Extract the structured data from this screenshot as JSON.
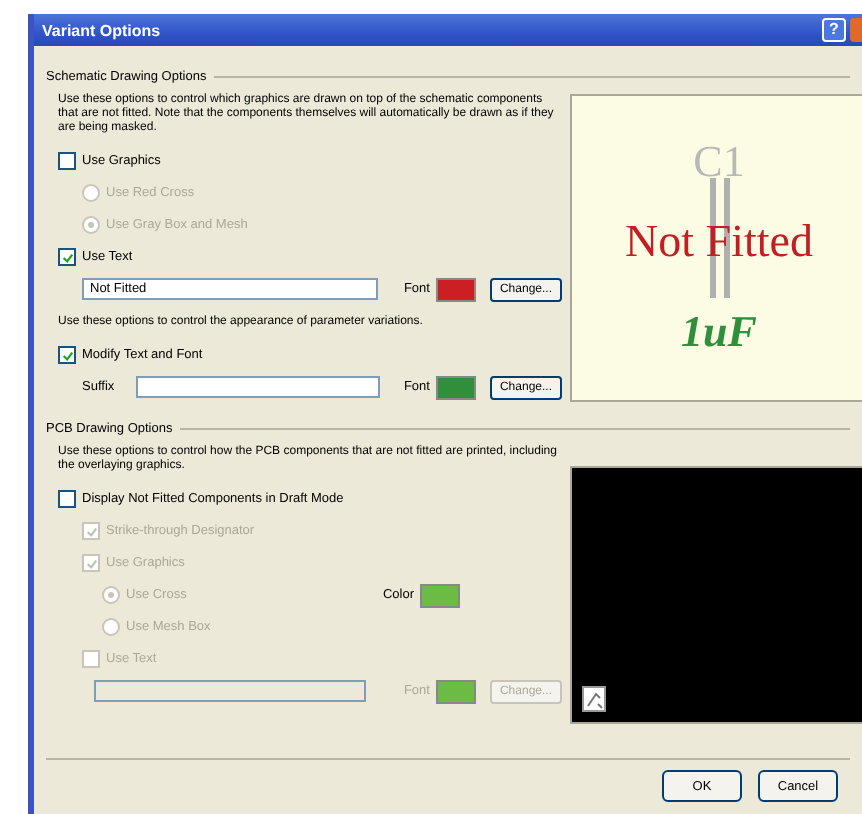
{
  "window": {
    "title": "Variant Options",
    "help": "?"
  },
  "schematic": {
    "heading": "Schematic Drawing Options",
    "description": "Use these options to control which graphics are drawn on top of the schematic components that are not fitted. Note that the components themselves will automatically be drawn as if they are being masked.",
    "use_graphics": {
      "label": "Use Graphics",
      "checked": false
    },
    "radios": [
      {
        "label": "Use Red Cross",
        "selected": false,
        "disabled": true
      },
      {
        "label": "Use Gray Box and Mesh",
        "selected": true,
        "disabled": true
      }
    ],
    "use_text": {
      "label": "Use Text",
      "checked": true
    },
    "text_field": {
      "value": "Not Fitted",
      "font_label": "Font",
      "color": "#cc1f24",
      "button": "Change..."
    },
    "param_description": "Use these options to control the appearance of parameter variations.",
    "modify": {
      "label": "Modify Text and Font",
      "checked": true
    },
    "suffix": {
      "label": "Suffix",
      "font_label": "Font",
      "color": "#2f8f3a",
      "button": "Change..."
    },
    "preview": {
      "designator": "C1",
      "overlay": "Not Fitted",
      "value": "1uF"
    }
  },
  "pcb": {
    "heading": "PCB Drawing Options",
    "description": "Use these options to control how the PCB components that are not fitted are printed, including the overlaying graphics.",
    "display": {
      "label": "Display Not Fitted Components in Draft Mode",
      "checked": false
    },
    "options": [
      {
        "kind": "checkbox",
        "label": "Strike-through Designator",
        "checked": true,
        "disabled": true
      },
      {
        "kind": "checkbox",
        "label": "Use Graphics",
        "checked": true,
        "disabled": true
      },
      {
        "kind": "radio",
        "label": "Use Cross",
        "selected": true,
        "disabled": true
      },
      {
        "kind": "radio",
        "label": "Use Mesh Box",
        "selected": false,
        "disabled": true
      },
      {
        "kind": "checkbox",
        "label": "Use Text",
        "checked": false,
        "disabled": true
      }
    ],
    "color_label": "Color",
    "color": "#6cbb45",
    "text_field": {
      "disabled": true,
      "font_label": "Font",
      "color": "#6cbb45",
      "button": "Change..."
    }
  },
  "buttons": [
    "OK",
    "Cancel"
  ]
}
